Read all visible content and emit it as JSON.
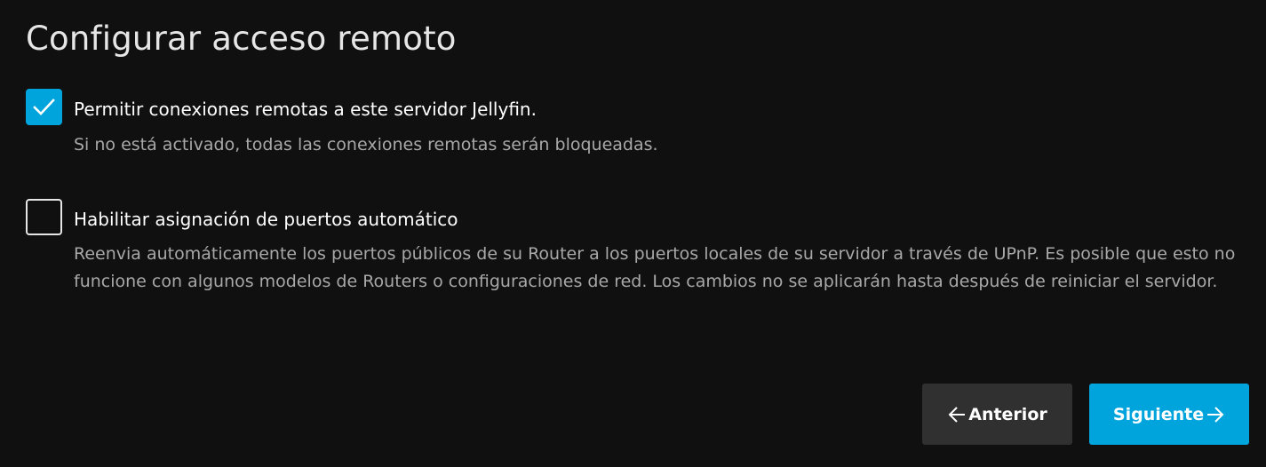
{
  "page": {
    "title": "Configurar acceso remoto"
  },
  "options": [
    {
      "label": "Permitir conexiones remotas a este servidor Jellyfin.",
      "description": "Si no está activado, todas las conexiones remotas serán bloqueadas.",
      "checked": true
    },
    {
      "label": "Habilitar asignación de puertos automático",
      "description": "Reenvia automáticamente los puertos públicos de su Router a los puertos locales de su servidor a través de UPnP. Es posible que esto no funcione con algunos modelos de Routers o configuraciones de red. Los cambios no se aplicarán hasta después de reiniciar el servidor.",
      "checked": false
    }
  ],
  "buttons": {
    "previous_label": "Anterior",
    "previous_icon": "arrow-left-icon",
    "next_label": "Siguiente",
    "next_icon": "arrow-right-icon"
  },
  "colors": {
    "background": "#101010",
    "accent": "#00a4dc",
    "secondary_button": "#303030",
    "description_text": "#a8a8a8"
  }
}
